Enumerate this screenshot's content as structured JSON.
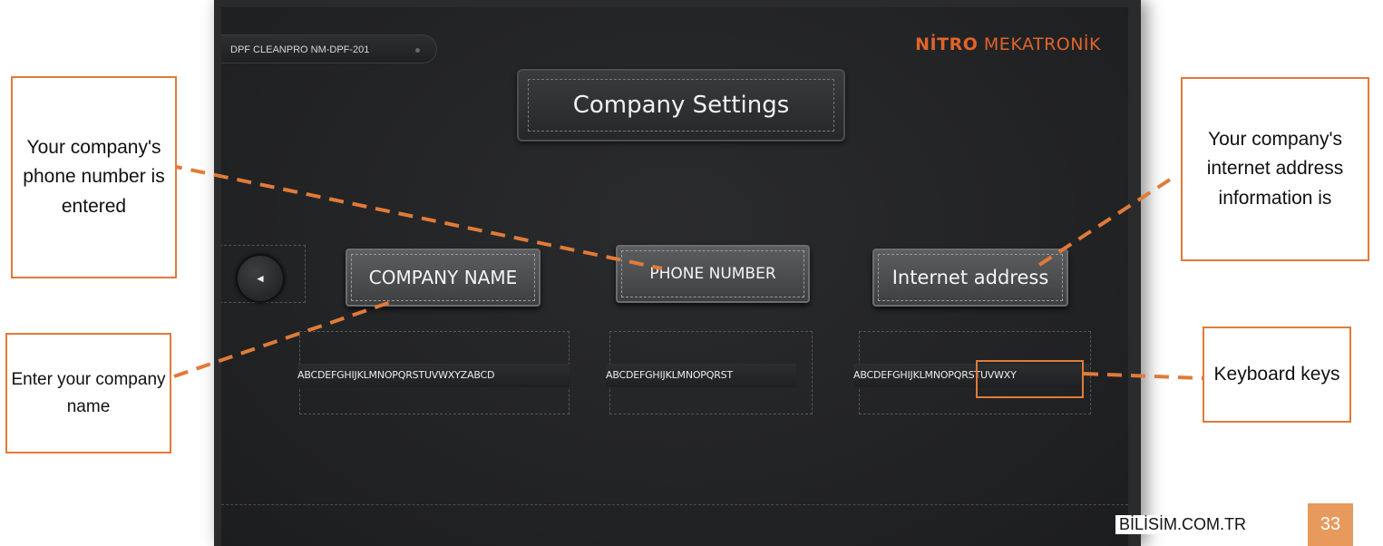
{
  "device": {
    "model_label": "DPF CLEANPRO NM-DPF-201",
    "brand_part1": "NİTRO",
    "brand_part2": " MEKATRONİK"
  },
  "screen": {
    "title": "Company Settings",
    "back_icon": "◄",
    "fields": [
      {
        "label": "COMPANY NAME",
        "keys": "ABCDEFGHIJKLMNOPQRSTUVWXYZABCD"
      },
      {
        "label": "PHONE NUMBER",
        "keys": "ABCDEFGHIJKLMNOPQRST"
      },
      {
        "label": "Internet address",
        "keys": "ABCDEFGHIJKLMNOPQRSTUVWXY"
      }
    ]
  },
  "callouts": {
    "phone": "Your company's phone number is entered",
    "internet": "Your company's internet address information is",
    "name": "Enter your company name",
    "keyboard": "Keyboard keys"
  },
  "footer": {
    "site": "BİLİSİM.COM.TR",
    "page_number": "33"
  },
  "colors": {
    "accent": "#e07b39",
    "brand": "#e0642a",
    "page_badge": "#e79a5c",
    "screen_bg": "#222325"
  }
}
